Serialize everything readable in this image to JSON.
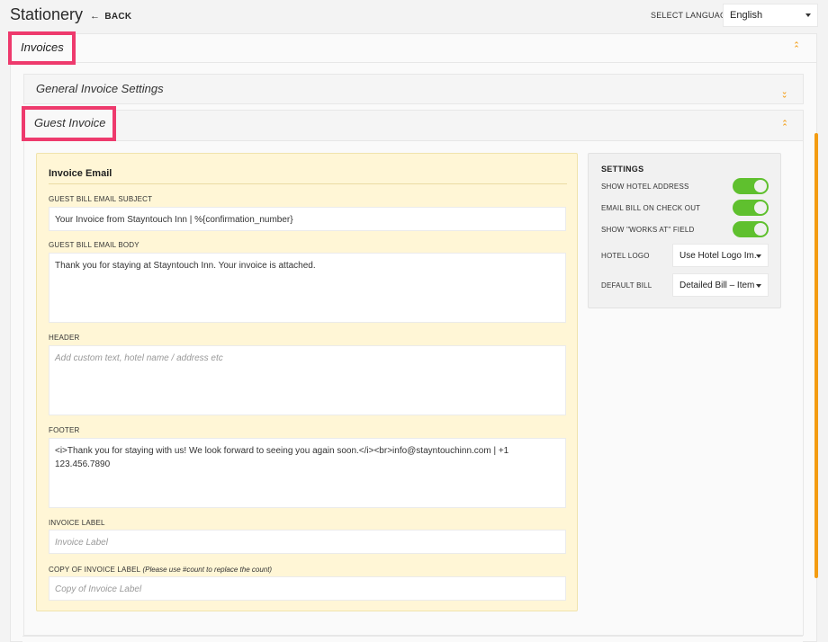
{
  "topbar": {
    "title": "Stationery",
    "back_label": "BACK",
    "back_icon": "arrow-left-icon",
    "language_label": "SELECT LANGUAGE",
    "language_value": "English"
  },
  "invoices": {
    "title": "Invoices",
    "expanded": true,
    "sections": {
      "general": {
        "title": "General Invoice Settings",
        "expanded": false
      },
      "guest": {
        "title": "Guest Invoice",
        "expanded": true
      }
    }
  },
  "invoice_email": {
    "title": "Invoice Email",
    "subject_label": "GUEST BILL EMAIL SUBJECT",
    "subject_value": "Your Invoice from Stayntouch Inn | %{confirmation_number}",
    "body_label": "GUEST BILL EMAIL BODY",
    "body_value": "Thank you for staying at Stayntouch Inn. Your invoice is attached.",
    "header_label": "HEADER",
    "header_placeholder": "Add custom text, hotel name / address etc",
    "footer_label": "FOOTER",
    "footer_value": "<i>Thank you for staying with us! We look forward to seeing you again soon.</i><br>info@stayntouchinn.com  |  +1 123.456.7890",
    "invoice_label_label": "INVOICE LABEL",
    "invoice_label_placeholder": "Invoice Label",
    "copy_label_label": "COPY OF INVOICE LABEL",
    "copy_label_hint": "(Please use #count to replace the count)",
    "copy_label_placeholder": "Copy of Invoice Label"
  },
  "settings": {
    "title": "SETTINGS",
    "show_hotel_address_label": "SHOW HOTEL ADDRESS",
    "show_hotel_address": true,
    "email_bill_checkout_label": "EMAIL BILL ON CHECK OUT",
    "email_bill_checkout": true,
    "show_works_at_label": "SHOW \"WORKS AT\" FIELD",
    "show_works_at": true,
    "hotel_logo_label": "HOTEL LOGO",
    "hotel_logo_value": "Use Hotel Logo Im.",
    "default_bill_label": "DEFAULT BILL",
    "default_bill_value": "Detailed Bill – Item"
  },
  "colors": {
    "accent": "#f39c12",
    "highlight": "#ee3a6d",
    "toggle_on": "#5fc02e",
    "email_box_bg": "#fff6d6"
  }
}
